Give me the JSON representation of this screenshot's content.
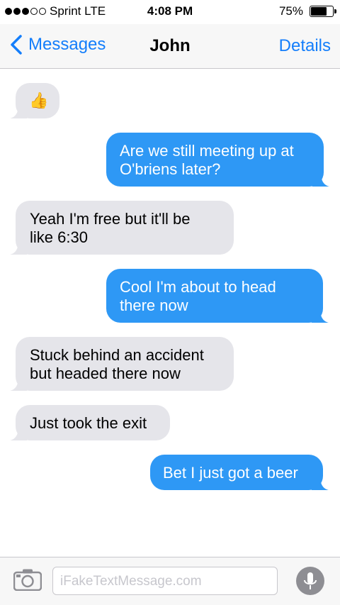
{
  "status_bar": {
    "carrier": "Sprint  LTE",
    "time": "4:08 PM",
    "battery_percent": "75%",
    "battery_level": 0.75,
    "signal_bars_filled": 3
  },
  "nav": {
    "back_label": "Messages",
    "title": "John",
    "details_label": "Details",
    "accent_color": "#147efb"
  },
  "messages": [
    {
      "direction": "incoming",
      "text": "👍"
    },
    {
      "direction": "outgoing",
      "text": "Are we still meeting up at\nO'briens later?"
    },
    {
      "direction": "incoming",
      "text": "Yeah I'm free but it'll be\nlike 6:30"
    },
    {
      "direction": "outgoing",
      "text": "Cool I'm about to head\nthere now"
    },
    {
      "direction": "incoming",
      "text": "Stuck behind an accident\nbut headed there now"
    },
    {
      "direction": "incoming",
      "text": "Just took the exit"
    },
    {
      "direction": "outgoing",
      "text": "Bet I just got a beer"
    }
  ],
  "input_bar": {
    "placeholder": "iFakeTextMessage.com",
    "camera_icon": "camera-icon",
    "mic_icon": "microphone-icon"
  },
  "colors": {
    "incoming_bubble": "#e5e5ea",
    "outgoing_bubble": "#2e98f5"
  }
}
